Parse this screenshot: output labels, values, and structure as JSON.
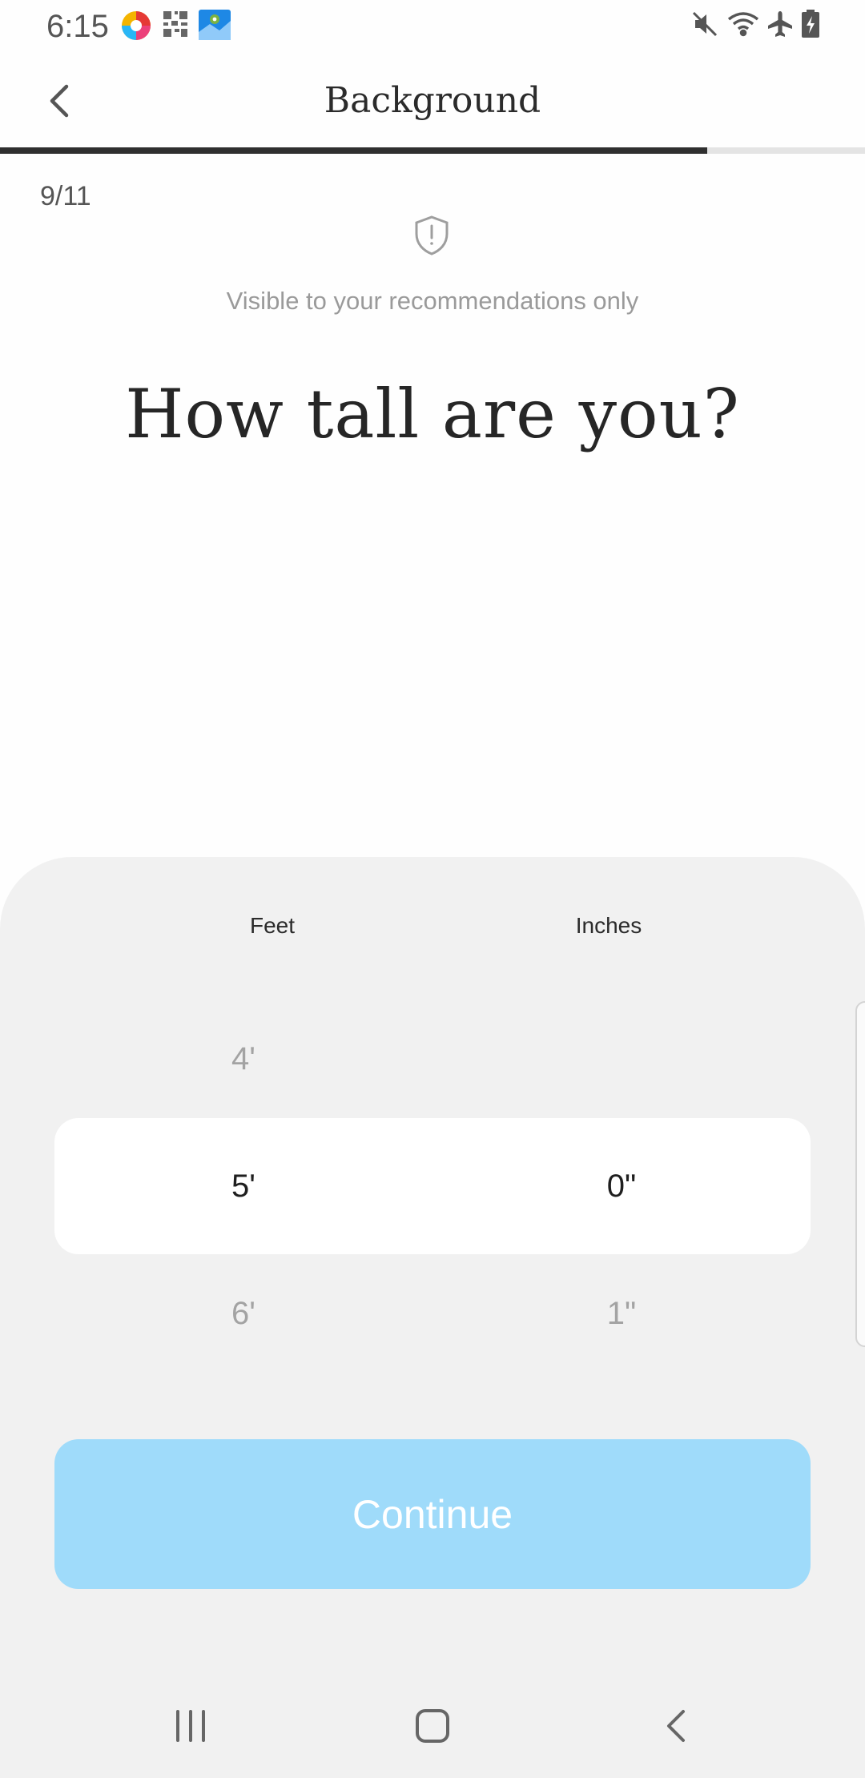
{
  "status_bar": {
    "time": "6:15",
    "left_icons": [
      "photos-app-icon",
      "qr-code-icon",
      "maps-app-icon"
    ],
    "right_icons": [
      "mute-icon",
      "wifi-icon",
      "airplane-mode-icon",
      "battery-icon"
    ]
  },
  "header": {
    "title": "Background",
    "back_icon": "chevron-left-icon",
    "progress": 0.818
  },
  "step": {
    "current": 9,
    "total": 11,
    "label": "9/11"
  },
  "visibility": {
    "icon": "shield-alert-icon",
    "text": "Visible to your recommendations only"
  },
  "question": "How tall are you?",
  "picker": {
    "feet_header": "Feet",
    "inches_header": "Inches",
    "feet": {
      "above": "4'",
      "selected": "5'",
      "below": "6'"
    },
    "inches": {
      "above": "",
      "selected": "0\"",
      "below": "1\""
    }
  },
  "continue": {
    "label": "Continue",
    "color": "#9fdbfa"
  },
  "nav_bar": {
    "icons": [
      "recent-apps-icon",
      "home-icon",
      "back-icon"
    ]
  }
}
